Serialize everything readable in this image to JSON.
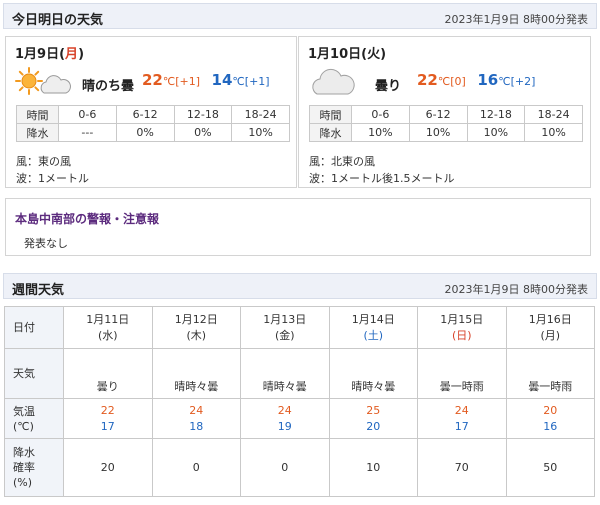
{
  "header_today": {
    "title": "今日明日の天気",
    "announced": "2023年1月9日 8時00分発表"
  },
  "today": {
    "date": "1月9日",
    "weekday_open": "(",
    "weekday": "月",
    "weekday_close": ")",
    "weather_icon": "sun-with-cloud-icon",
    "weather_text": "晴のち曇",
    "high": "22",
    "high_unit": "℃",
    "high_diff": "[+1]",
    "low": "14",
    "low_unit": "℃",
    "low_diff": "[+1]",
    "rain_label": "時間",
    "rain_row_label": "降水",
    "periods": [
      "0-6",
      "6-12",
      "12-18",
      "18-24"
    ],
    "rain": [
      "---",
      "0%",
      "0%",
      "10%"
    ],
    "wind": "風：東の風",
    "wave": "波：1メートル"
  },
  "tomorrow": {
    "date": "1月10日",
    "weekday_open": "(",
    "weekday": "火",
    "weekday_close": ")",
    "weather_icon": "cloud-icon",
    "weather_text": "曇り",
    "high": "22",
    "high_unit": "℃",
    "high_diff": "[0]",
    "low": "16",
    "low_unit": "℃",
    "low_diff": "[+2]",
    "rain_label": "時間",
    "rain_row_label": "降水",
    "periods": [
      "0-6",
      "6-12",
      "12-18",
      "18-24"
    ],
    "rain": [
      "10%",
      "10%",
      "10%",
      "10%"
    ],
    "wind": "風：北東の風",
    "wave": "波：1メートル後1.5メートル"
  },
  "alert": {
    "title": "本島中南部の警報・注意報",
    "body": "発表なし"
  },
  "header_weekly": {
    "title": "週間天気",
    "announced": "2023年1月9日 8時00分発表"
  },
  "weekly": {
    "labels": {
      "date": "日付",
      "weather": "天気",
      "temp_line1": "気温",
      "temp_line2": "(℃)",
      "pop_line1": "降水",
      "pop_line2": "確率",
      "pop_line3": "(%)"
    },
    "days": [
      {
        "date": "1月11日",
        "wd": "(水)",
        "wd_color": "normal",
        "icon": "cloud-icon",
        "weather": "曇り",
        "high": "22",
        "low": "17",
        "pop": "20"
      },
      {
        "date": "1月12日",
        "wd": "(木)",
        "wd_color": "normal",
        "icon": "sun-with-cloud-icon",
        "weather": "晴時々曇",
        "high": "24",
        "low": "18",
        "pop": "0"
      },
      {
        "date": "1月13日",
        "wd": "(金)",
        "wd_color": "normal",
        "icon": "sun-with-cloud-icon",
        "weather": "晴時々曇",
        "high": "24",
        "low": "19",
        "pop": "0"
      },
      {
        "date": "1月14日",
        "wd": "(土)",
        "wd_color": "sat",
        "icon": "sun-with-cloud-icon",
        "weather": "晴時々曇",
        "high": "25",
        "low": "20",
        "pop": "10"
      },
      {
        "date": "1月15日",
        "wd": "(日)",
        "wd_color": "sun",
        "icon": "cloud-with-umbrella-icon",
        "weather": "曇一時雨",
        "high": "24",
        "low": "17",
        "pop": "70"
      },
      {
        "date": "1月16日",
        "wd": "(月)",
        "wd_color": "normal",
        "icon": "cloud-with-umbrella-icon",
        "weather": "曇一時雨",
        "high": "20",
        "low": "16",
        "pop": "50"
      }
    ]
  },
  "colors": {
    "high": "#e25b20",
    "low": "#2167c0",
    "sunday": "#d8432a",
    "saturday": "#2167c0",
    "alert_title": "#5c2b7e",
    "header_bg": "#eef1f8"
  }
}
